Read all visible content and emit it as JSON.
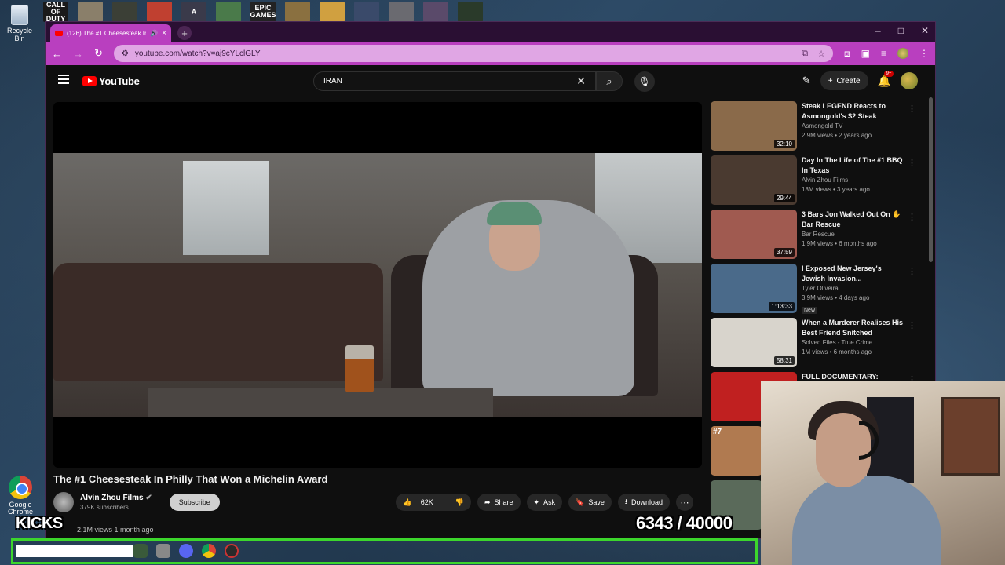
{
  "desktop": {
    "recycle_bin_label": "Recycle Bin",
    "chrome_label": "Google Chrome",
    "top_icons": [
      {
        "label": "CALL OF DUTY",
        "bg": "#1a1a1a",
        "color": "#fff"
      },
      {
        "label": "",
        "bg": "#8a7f6a",
        "color": "#fff"
      },
      {
        "label": "",
        "bg": "#3b3f36",
        "color": "#fff"
      },
      {
        "label": "",
        "bg": "#c04030",
        "color": "#fff"
      },
      {
        "label": "A",
        "bg": "#3a3a4a",
        "color": "#fff"
      },
      {
        "label": "",
        "bg": "#4a7a4a",
        "color": "#fff"
      },
      {
        "label": "EPIC GAMES",
        "bg": "#222222",
        "color": "#fff"
      },
      {
        "label": "",
        "bg": "#8a7040",
        "color": "#fff"
      },
      {
        "label": "",
        "bg": "#d0a040",
        "color": "#fff"
      },
      {
        "label": "",
        "bg": "#3a4a6a",
        "color": "#fff"
      },
      {
        "label": "",
        "bg": "#6a6a70",
        "color": "#fff"
      },
      {
        "label": "",
        "bg": "#5a4a6a",
        "color": "#fff"
      },
      {
        "label": "",
        "bg": "#2a3a2a",
        "color": "#9f3"
      }
    ]
  },
  "browser": {
    "tab_title": "(126) The #1 Cheesesteak In",
    "tab_close": "×",
    "new_tab": "+",
    "window_controls": [
      "–",
      "□",
      "✕"
    ],
    "url": "youtube.com/watch?v=aj9cYLclGLY",
    "accent": "#b93fbf"
  },
  "youtube": {
    "logo_text": "YouTube",
    "search_value": "IRAN",
    "create_label": "Create",
    "notification_count": "9+",
    "video": {
      "title": "The #1 Cheesesteak In Philly That Won a Michelin Award",
      "channel": "Alvin Zhou Films",
      "subscribers": "379K subscribers",
      "subscribe_label": "Subscribe",
      "likes": "62K",
      "share_label": "Share",
      "ask_label": "Ask",
      "save_label": "Save",
      "download_label": "Download",
      "views_date": "2.1M views  1 month ago"
    },
    "recommendations": [
      {
        "title": "Steak LEGEND Reacts to Asmongold's $2 Steak",
        "channel": "Asmongold TV",
        "meta": "2.9M views • 2 years ago",
        "duration": "32:10",
        "new": "",
        "thumb": "#8a6a4a"
      },
      {
        "title": "Day In The Life of The #1 BBQ In Texas",
        "channel": "Alvin Zhou Films",
        "meta": "18M views • 3 years ago",
        "duration": "29:44",
        "new": "",
        "thumb": "#4a3a30"
      },
      {
        "title": "3 Bars Jon Walked Out On ✋ Bar Rescue",
        "channel": "Bar Rescue",
        "meta": "1.9M views • 6 months ago",
        "duration": "37:59",
        "new": "",
        "thumb": "#a05a50"
      },
      {
        "title": "I Exposed New Jersey's Jewish Invasion...",
        "channel": "Tyler Oliveira",
        "meta": "3.9M views • 4 days ago",
        "duration": "1:13:33",
        "new": "New",
        "thumb": "#4a6a8a"
      },
      {
        "title": "When a Murderer Realises His Best Friend Snitched",
        "channel": "Solved Files - True Crime",
        "meta": "1M views • 6 months ago",
        "duration": "58:31",
        "new": "",
        "thumb": "#d8d4cc"
      },
      {
        "title": "FULL DOCUMENTARY:",
        "channel": "",
        "meta": "",
        "duration": "",
        "new": "",
        "thumb": "#c02020"
      }
    ],
    "extra_thumbs": [
      {
        "label": "#7",
        "thumb": "#b07a50"
      },
      {
        "label": "",
        "thumb": "#5a6a5a"
      }
    ]
  },
  "overlay": {
    "kicks_label": "KICKS",
    "counter_text": "6343  / 40000",
    "progress_fraction": 0.158,
    "bar_color": "#3cd62c"
  }
}
